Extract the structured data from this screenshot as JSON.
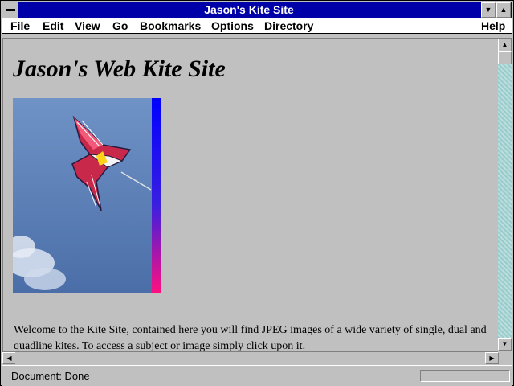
{
  "window": {
    "title": "Jason's Kite Site"
  },
  "menu": {
    "items": [
      {
        "label": "File"
      },
      {
        "label": "Edit"
      },
      {
        "label": "View"
      },
      {
        "label": "Go"
      },
      {
        "label": "Bookmarks"
      },
      {
        "label": "Options"
      },
      {
        "label": "Directory"
      },
      {
        "label": "Help"
      }
    ]
  },
  "page": {
    "heading": "Jason's Web Kite Site",
    "welcome": "Welcome to the Kite Site, contained here you will find JPEG images of a wide variety of single, dual and quadline kites. To access a subject or image simply click upon it."
  },
  "status": {
    "text": "Document: Done"
  },
  "colors": {
    "titlebar": "#0000a8",
    "page_bg": "#c0c0c0",
    "sky": "#5b7fb8"
  }
}
